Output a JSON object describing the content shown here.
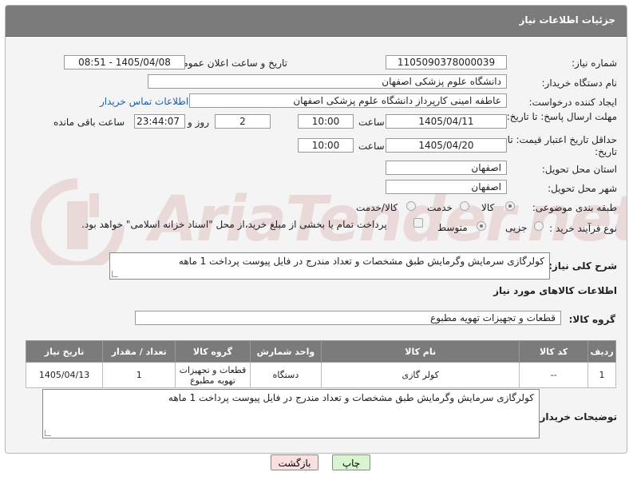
{
  "header": {
    "title": "جزئیات اطلاعات نیاز"
  },
  "labels": {
    "need_number": "شماره نیاز:",
    "announce_datetime": "تاریخ و ساعت اعلان عمومی:",
    "buyer_org": "نام دستگاه خریدار:",
    "requester": "ایجاد کننده درخواست:",
    "reply_deadline": "مهلت ارسال پاسخ: تا تاریخ:",
    "time": "ساعت",
    "day_and": "روز و",
    "remaining": "ساعت باقی مانده",
    "price_validity": "حداقل تاریخ اعتبار قیمت: تا تاریخ:",
    "province": "استان محل تحویل:",
    "city": "شهر محل تحویل:",
    "category": "طبقه بندی موضوعی:",
    "process_type": "نوع فرآیند خرید :",
    "general_desc": "شرح کلی نیاز:",
    "goods_info": "اطلاعات کالاهای مورد نیاز",
    "goods_group": "گروه کالا:",
    "buyer_notes": "توضیحات خریدار:"
  },
  "values": {
    "need_number": "1105090378000039",
    "announce_datetime": "1405/04/08 - 08:51",
    "buyer_org": "دانشگاه علوم پزشکی اصفهان",
    "requester": "عاطفه امینی کارپرداز دانشگاه علوم پزشکی اصفهان",
    "contact_link": "اطلاعات تماس خریدار",
    "reply_date": "1405/04/11",
    "reply_time": "10:00",
    "days": "2",
    "remaining_time": "23:44:07",
    "price_date": "1405/04/20",
    "price_time": "10:00",
    "province": "اصفهان",
    "city": "اصفهان",
    "general_desc": "کولرگازی سرمایش وگرمایش طبق مشخصات و تعداد مندرج در فایل پیوست پرداخت 1 ماهه",
    "goods_group": "قطعات و تجهیزات تهویه مطبوع",
    "buyer_notes": "کولرگازی سرمایش وگرمایش طبق مشخصات و تعداد مندرج در فایل پیوست پرداخت 1 ماهه"
  },
  "category_options": {
    "goods": "کالا",
    "service": "خدمت",
    "goods_service": "کالا/خدمت",
    "selected": "کالا"
  },
  "process_options": {
    "partial": "جزیی",
    "medium": "متوسط",
    "selected": "متوسط",
    "payment_note": "پرداخت تمام یا بخشی از مبلغ خرید،از محل \"اسناد خزانه اسلامی\" خواهد بود."
  },
  "table": {
    "headers": [
      "ردیف",
      "کد کالا",
      "نام کالا",
      "واحد شمارش",
      "گروه کالا",
      "تعداد / مقدار",
      "تاریخ نیاز"
    ],
    "rows": [
      [
        "1",
        "--",
        "کولر گازی",
        "دستگاه",
        "قطعات و تجهیزات تهویه مطبوع",
        "1",
        "1405/04/13"
      ]
    ]
  },
  "buttons": {
    "print": "چاپ",
    "back": "بازگشت"
  },
  "watermark": {
    "text": "AriaTender.net"
  },
  "colors": {
    "header_bg": "#7b7b7b",
    "link": "#1a5dad",
    "print_btn": "#d9f5d0",
    "back_btn": "#fbe0e0"
  }
}
